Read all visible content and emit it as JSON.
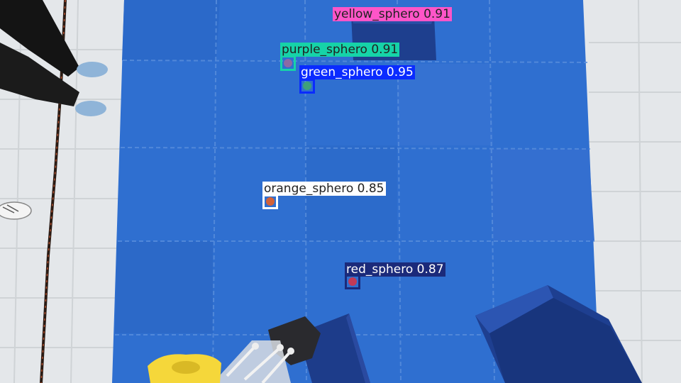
{
  "detections": [
    {
      "id": "yellow",
      "class_name": "yellow_sphero",
      "confidence": "0.91",
      "color": "#ff55c8",
      "text_color": "#222222"
    },
    {
      "id": "purple",
      "class_name": "purple_sphero",
      "confidence": "0.91",
      "color": "#16d3a8",
      "text_color": "#222222"
    },
    {
      "id": "green",
      "class_name": "green_sphero",
      "confidence": "0.95",
      "color": "#0a2bff",
      "text_color": "#ffffff"
    },
    {
      "id": "orange",
      "class_name": "orange_sphero",
      "confidence": "0.85",
      "color": "#ffffff",
      "text_color": "#222222"
    },
    {
      "id": "red",
      "class_name": "red_sphero",
      "confidence": "0.87",
      "color": "#1b2a7a",
      "text_color": "#ffffff"
    }
  ]
}
